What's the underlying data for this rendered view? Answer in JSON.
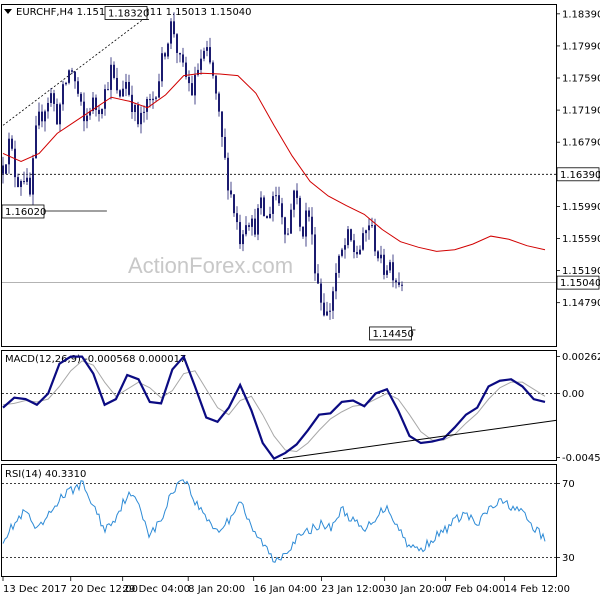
{
  "title": "EURCHF,H4  1.15160 1.15211 1.15013 1.15040",
  "watermark": "ActionForex.com",
  "colors": {
    "candles": "#1b1b6f",
    "ma": "#d10000",
    "macd": "#0b0b82",
    "signal": "#a8a8a8",
    "rsi": "#2e8bd6",
    "trend": "#000000",
    "frame": "#000000"
  },
  "chart_data": [
    {
      "type": "line",
      "name": "price",
      "title": "EURCHF,H4  1.15160 1.15211 1.15013 1.15040",
      "ylim": [
        1.1425,
        1.185
      ],
      "yticks": [
        "1.18390",
        "1.17990",
        "1.17590",
        "1.17190",
        "1.16790",
        "1.16390",
        "1.15990",
        "1.15590",
        "1.15190",
        "1.14790"
      ],
      "ytick_values": [
        1.1839,
        1.1799,
        1.1759,
        1.1719,
        1.1679,
        1.1639,
        1.1599,
        1.1559,
        1.1519,
        1.1479
      ],
      "price_x": [
        0,
        3,
        6,
        9,
        12,
        15,
        18,
        21,
        24,
        27,
        30,
        33,
        36,
        39,
        42,
        45,
        48,
        51,
        54,
        57,
        60,
        63,
        66,
        69,
        72,
        75,
        78,
        81,
        84,
        87,
        90,
        93,
        96,
        99,
        102,
        105,
        108,
        111,
        114,
        117,
        120,
        123,
        126,
        129,
        132,
        135,
        138,
        141,
        144,
        147,
        150,
        153,
        156,
        159,
        162,
        165,
        168,
        171,
        174,
        177,
        180,
        183,
        186,
        189,
        192,
        195,
        198,
        201,
        204,
        207,
        210,
        213,
        216,
        219,
        222,
        225,
        228,
        231,
        234,
        237,
        240
      ],
      "close": [
        1.165,
        1.168,
        1.163,
        1.164,
        1.161,
        1.17,
        1.172,
        1.174,
        1.171,
        1.1745,
        1.1775,
        1.174,
        1.17,
        1.173,
        1.172,
        1.174,
        1.177,
        1.173,
        1.176,
        1.173,
        1.17,
        1.172,
        1.173,
        1.176,
        1.18,
        1.183,
        1.178,
        1.176,
        1.174,
        1.178,
        1.179,
        1.176,
        1.17,
        1.164,
        1.16,
        1.156,
        1.159,
        1.157,
        1.16,
        1.158,
        1.162,
        1.16,
        1.156,
        1.163,
        1.156,
        1.16,
        1.153,
        1.148,
        1.146,
        1.151,
        1.154,
        1.156,
        1.154,
        1.155,
        1.158,
        1.155,
        1.152,
        1.153,
        1.151,
        1.1504
      ],
      "candle_sigma": 0.0016,
      "ma_x": [
        0,
        8,
        16,
        24,
        32,
        40,
        48,
        56,
        64,
        72,
        80,
        88,
        96,
        104,
        112,
        120,
        128,
        136,
        144,
        152,
        160,
        168,
        176,
        184,
        192,
        200,
        208,
        216,
        224,
        232,
        240
      ],
      "ma": [
        1.1665,
        1.1655,
        1.1665,
        1.169,
        1.1705,
        1.172,
        1.1735,
        1.173,
        1.1722,
        1.1738,
        1.1762,
        1.1765,
        1.1764,
        1.1762,
        1.174,
        1.17,
        1.1662,
        1.163,
        1.1612,
        1.16,
        1.1589,
        1.157,
        1.1555,
        1.1548,
        1.1543,
        1.1545,
        1.1552,
        1.1562,
        1.1558,
        1.155,
        1.1545
      ],
      "hline": 1.1639,
      "hline_label": "1.16390",
      "last": 1.1504,
      "last_label": "1.15040",
      "markers": [
        {
          "x": 46,
          "value": 1.1602,
          "label": "1.16020"
        },
        {
          "x": 62,
          "value": 1.1832,
          "label": "1.18320"
        },
        {
          "x": 180,
          "value": 1.1445,
          "label": "1.14450"
        }
      ],
      "trendline": [
        {
          "x": 0,
          "value": 1.17
        },
        {
          "x": 62,
          "value": 1.1832
        }
      ]
    },
    {
      "type": "line",
      "name": "macd",
      "title": "MACD(12,26,9) -0.000568 0.000017",
      "ylim": [
        -0.0047,
        0.003
      ],
      "yticks": [
        "0.00262",
        "0.00",
        "-0.004526"
      ],
      "ytick_values": [
        0.00262,
        0.0,
        -0.004526
      ],
      "x": [
        0,
        5,
        10,
        15,
        20,
        25,
        30,
        35,
        40,
        45,
        50,
        55,
        60,
        65,
        70,
        75,
        80,
        85,
        90,
        95,
        100,
        105,
        110,
        115,
        120,
        125,
        130,
        135,
        140,
        145,
        150,
        155,
        160,
        165,
        170,
        175,
        180,
        185,
        190,
        195,
        200,
        205,
        210,
        215,
        220,
        225,
        230,
        235,
        240
      ],
      "macd": [
        -0.001,
        -0.0003,
        -0.0004,
        -0.0008,
        0.0,
        0.0021,
        0.0026,
        0.0026,
        0.0014,
        -0.0008,
        -0.0004,
        0.0013,
        0.001,
        -0.0006,
        -0.0007,
        0.0017,
        0.0026,
        0.0005,
        -0.0017,
        -0.002,
        -0.001,
        0.0006,
        -0.0012,
        -0.0035,
        -0.0046,
        -0.0042,
        -0.0036,
        -0.0026,
        -0.0015,
        -0.0014,
        -0.0006,
        -0.0005,
        -0.0009,
        0.0,
        0.0003,
        -0.0012,
        -0.003,
        -0.0035,
        -0.0034,
        -0.0032,
        -0.0024,
        -0.0015,
        -0.001,
        0.0005,
        0.0009,
        0.001,
        0.0005,
        -0.0004,
        -0.0006
      ],
      "signal": [
        -0.0008,
        -0.0007,
        -0.0005,
        -0.0006,
        -0.0004,
        0.0005,
        0.0016,
        0.0023,
        0.002,
        0.0008,
        -0.0002,
        0.0003,
        0.0008,
        0.0004,
        -0.0003,
        0.0002,
        0.0014,
        0.0016,
        0.0003,
        -0.001,
        -0.0015,
        -0.0005,
        -0.0002,
        -0.0015,
        -0.003,
        -0.004,
        -0.0041,
        -0.0035,
        -0.0026,
        -0.0018,
        -0.0013,
        -0.0009,
        -0.0008,
        -0.0004,
        0.0,
        -0.0004,
        -0.0015,
        -0.0027,
        -0.0033,
        -0.0033,
        -0.0029,
        -0.0021,
        -0.0014,
        -0.0004,
        0.0004,
        0.0008,
        0.0008,
        0.0003,
        -0.0002
      ],
      "trendline": [
        {
          "x": 124,
          "value": -0.0046
        },
        {
          "x": 240,
          "value": -0.0019
        }
      ]
    },
    {
      "type": "line",
      "name": "rsi",
      "title": "RSI(14) 40.3310",
      "ylim": [
        20,
        80
      ],
      "yticks": [
        "70",
        "30"
      ],
      "ytick_values": [
        70,
        30
      ],
      "x": [
        0,
        5,
        10,
        15,
        20,
        25,
        30,
        35,
        40,
        45,
        50,
        55,
        60,
        65,
        70,
        75,
        80,
        85,
        90,
        95,
        100,
        105,
        110,
        115,
        120,
        125,
        130,
        135,
        140,
        145,
        150,
        155,
        160,
        165,
        170,
        175,
        180,
        185,
        190,
        195,
        200,
        205,
        210,
        215,
        220,
        225,
        230,
        235,
        240
      ],
      "rsi": [
        40,
        48,
        55,
        44,
        52,
        62,
        66,
        70,
        58,
        45,
        52,
        64,
        60,
        42,
        50,
        66,
        74,
        60,
        52,
        44,
        50,
        62,
        45,
        38,
        28,
        33,
        40,
        44,
        48,
        46,
        56,
        50,
        44,
        52,
        58,
        46,
        36,
        34,
        40,
        44,
        50,
        54,
        47,
        56,
        60,
        58,
        54,
        46,
        40
      ]
    }
  ],
  "x_axis": {
    "labels": [
      "13 Dec 2017",
      "20 Dec 12:00",
      "29 Dec 04:00",
      "8 Jan 20:00",
      "16 Jan 04:00",
      "23 Jan 12:00",
      "30 Jan 20:00",
      "7 Feb 04:00",
      "14 Feb 12:00"
    ],
    "positions": [
      0,
      30,
      53,
      82,
      111,
      141,
      169,
      196,
      222
    ]
  }
}
